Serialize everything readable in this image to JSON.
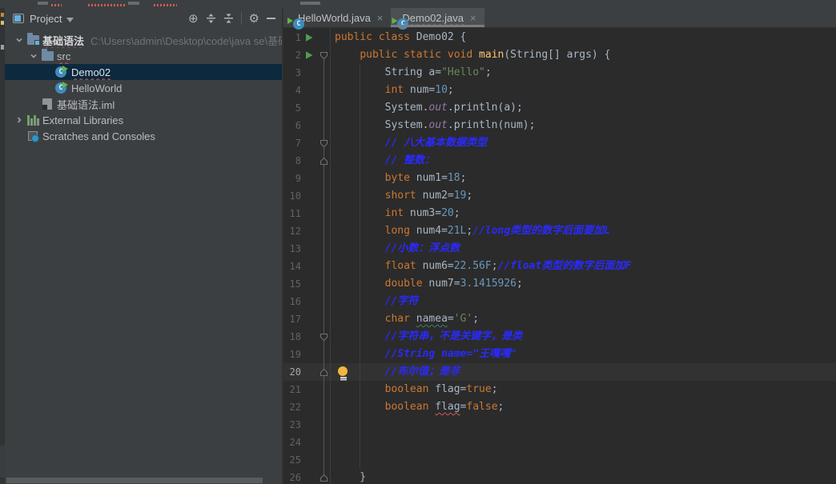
{
  "palette": {
    "panel_bg": "#3c3f41",
    "editor_bg": "#2b2b2b",
    "selection_bg": "#0d293e",
    "caret_row_bg": "#323232",
    "active_tab_bg": "#4c5052",
    "tree_text": "#bbbdbf",
    "linenum": "#606366",
    "keyword": "#cc7832",
    "plain": "#a9b7c6",
    "string": "#6a8759",
    "number": "#6897bb",
    "comment": "#2a2aff",
    "field": "#9876aa",
    "method": "#ffc66d",
    "error_red": "#cf5b56",
    "folder_blue": "#6f8aa5"
  },
  "project_panel": {
    "title": "Project",
    "header_icons": [
      "locate-icon",
      "expand-all-icon",
      "collapse-all-icon",
      "settings-icon",
      "hide-panel-icon"
    ],
    "tree": [
      {
        "name": "project-root",
        "label": "基础语法",
        "path": "C:\\Users\\admin\\Desktop\\code\\java se\\基础",
        "level": 0,
        "chevron": "down",
        "icon": "project-folder",
        "bold": true,
        "error": true
      },
      {
        "name": "src-folder",
        "label": "src",
        "level": 1,
        "chevron": "down",
        "icon": "folder",
        "error": true
      },
      {
        "name": "demo02-class",
        "label": "Demo02",
        "level": 2,
        "icon": "java-class",
        "selected": true,
        "error": true
      },
      {
        "name": "helloworld-class",
        "label": "HelloWorld",
        "level": 2,
        "icon": "java-class"
      },
      {
        "name": "iml-file",
        "label": "基础语法.iml",
        "level": 1,
        "icon": "module-file"
      },
      {
        "name": "external-libraries",
        "label": "External Libraries",
        "level": 0,
        "chevron": "right",
        "icon": "libraries"
      },
      {
        "name": "scratches-and-consoles",
        "label": "Scratches and Consoles",
        "level": 0,
        "icon": "scratches"
      }
    ]
  },
  "tabs": [
    {
      "label": "HelloWorld.java",
      "active": false,
      "error": false
    },
    {
      "label": "Demo02.java",
      "active": true,
      "error": true
    }
  ],
  "editor": {
    "lines": [
      {
        "n": 1,
        "run": true,
        "segs": [
          [
            "kw",
            "public"
          ],
          [
            "pl",
            " "
          ],
          [
            "kw",
            "class"
          ],
          [
            "pl",
            " Demo02 {"
          ]
        ]
      },
      {
        "n": 2,
        "run": true,
        "fold": "open",
        "segs": [
          [
            "pl",
            "    "
          ],
          [
            "kw",
            "public"
          ],
          [
            "pl",
            " "
          ],
          [
            "kw",
            "static"
          ],
          [
            "pl",
            " "
          ],
          [
            "kw",
            "void"
          ],
          [
            "pl",
            " "
          ],
          [
            "fn",
            "main"
          ],
          [
            "pl",
            "(String[] args) {"
          ]
        ]
      },
      {
        "n": 3,
        "segs": [
          [
            "pl",
            "        String a="
          ],
          [
            "str",
            "\"Hello\""
          ],
          [
            "pl",
            ";"
          ]
        ]
      },
      {
        "n": 4,
        "segs": [
          [
            "pl",
            "        "
          ],
          [
            "kw",
            "int"
          ],
          [
            "pl",
            " num="
          ],
          [
            "num",
            "10"
          ],
          [
            "pl",
            ";"
          ]
        ]
      },
      {
        "n": 5,
        "segs": [
          [
            "pl",
            "        System."
          ],
          [
            "fld",
            "out"
          ],
          [
            "pl",
            ".println(a);"
          ]
        ]
      },
      {
        "n": 6,
        "segs": [
          [
            "pl",
            "        System."
          ],
          [
            "fld",
            "out"
          ],
          [
            "pl",
            ".println(num);"
          ]
        ]
      },
      {
        "n": 7,
        "fold": "open",
        "segs": [
          [
            "pl",
            "        "
          ],
          [
            "cmt",
            "// 八大基本数据类型"
          ]
        ]
      },
      {
        "n": 8,
        "fold": "close",
        "segs": [
          [
            "pl",
            "        "
          ],
          [
            "cmt",
            "// 整数："
          ]
        ]
      },
      {
        "n": 9,
        "segs": [
          [
            "pl",
            "        "
          ],
          [
            "kw",
            "byte"
          ],
          [
            "pl",
            " num1="
          ],
          [
            "num",
            "18"
          ],
          [
            "pl",
            ";"
          ]
        ]
      },
      {
        "n": 10,
        "segs": [
          [
            "pl",
            "        "
          ],
          [
            "kw",
            "short"
          ],
          [
            "pl",
            " num2="
          ],
          [
            "num",
            "19"
          ],
          [
            "pl",
            ";"
          ]
        ]
      },
      {
        "n": 11,
        "segs": [
          [
            "pl",
            "        "
          ],
          [
            "kw",
            "int"
          ],
          [
            "pl",
            " num3="
          ],
          [
            "num",
            "20"
          ],
          [
            "pl",
            ";"
          ]
        ]
      },
      {
        "n": 12,
        "segs": [
          [
            "pl",
            "        "
          ],
          [
            "kw",
            "long"
          ],
          [
            "pl",
            " num4="
          ],
          [
            "num",
            "21L"
          ],
          [
            "pl",
            ";"
          ],
          [
            "cmt",
            "//long类型的数字后面要加L"
          ]
        ]
      },
      {
        "n": 13,
        "segs": [
          [
            "pl",
            "        "
          ],
          [
            "cmt",
            "//小数：浮点数"
          ]
        ]
      },
      {
        "n": 14,
        "segs": [
          [
            "pl",
            "        "
          ],
          [
            "kw",
            "float"
          ],
          [
            "pl",
            " num6="
          ],
          [
            "num",
            "22.56F"
          ],
          [
            "pl",
            ";"
          ],
          [
            "cmt",
            "//float类型的数字后面加F"
          ]
        ]
      },
      {
        "n": 15,
        "segs": [
          [
            "pl",
            "        "
          ],
          [
            "kw",
            "double"
          ],
          [
            "pl",
            " num7="
          ],
          [
            "num",
            "3.1415926"
          ],
          [
            "pl",
            ";"
          ]
        ]
      },
      {
        "n": 16,
        "segs": [
          [
            "pl",
            "        "
          ],
          [
            "cmt",
            "//字符"
          ]
        ]
      },
      {
        "n": 17,
        "segs": [
          [
            "pl",
            "        "
          ],
          [
            "kw",
            "char"
          ],
          [
            "pl",
            " "
          ],
          [
            "warn",
            "namea"
          ],
          [
            "pl",
            "="
          ],
          [
            "str",
            "'G'"
          ],
          [
            "pl",
            ";"
          ]
        ]
      },
      {
        "n": 18,
        "fold": "open",
        "segs": [
          [
            "pl",
            "        "
          ],
          [
            "cmt",
            "//字符串，不是关键字，是类"
          ]
        ]
      },
      {
        "n": 19,
        "segs": [
          [
            "pl",
            "        "
          ],
          [
            "cmt",
            "//String name=\"王嘎嘎\""
          ]
        ]
      },
      {
        "n": 20,
        "fold": "close",
        "current": true,
        "bulb": true,
        "segs": [
          [
            "pl",
            "        "
          ],
          [
            "cmt",
            "//布尔值；是非"
          ]
        ]
      },
      {
        "n": 21,
        "segs": [
          [
            "pl",
            "        "
          ],
          [
            "kw",
            "boolean"
          ],
          [
            "pl",
            " flag="
          ],
          [
            "kw",
            "true"
          ],
          [
            "pl",
            ";"
          ]
        ]
      },
      {
        "n": 22,
        "segs": [
          [
            "pl",
            "        "
          ],
          [
            "kw",
            "boolean"
          ],
          [
            "pl",
            " "
          ],
          [
            "err",
            "flag"
          ],
          [
            "pl",
            "="
          ],
          [
            "kw",
            "false"
          ],
          [
            "pl",
            ";"
          ]
        ]
      },
      {
        "n": 23,
        "segs": []
      },
      {
        "n": 24,
        "segs": []
      },
      {
        "n": 25,
        "segs": []
      },
      {
        "n": 26,
        "fold": "close",
        "segs": [
          [
            "pl",
            "    }"
          ]
        ]
      }
    ]
  }
}
